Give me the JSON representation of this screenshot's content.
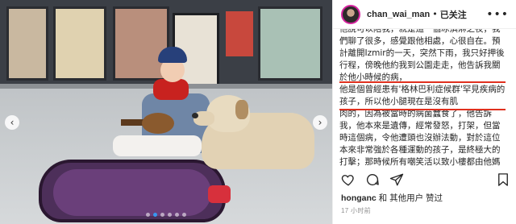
{
  "post": {
    "username": "chan_wai_man",
    "separator": "•",
    "follow_state": "已关注",
    "caption_top": "他說可以陪我，就是這一個冰淇淋之夜，我們聊了很多，感覺跟他相處，心很自在。預計離開Izmir的一天，突然下雨，我只好押後行程，傍晚他約我到公園走走，他告訴我關於他小時候的病，",
    "caption_highlight": "他是個曾經患有'格林巴利症候群'罕見疾病的孩子，所以他小腿現在是沒有肌",
    "caption_bottom": "肉的，因為被當時的病菌蠶食了，他告訴我，他本來是遺傳，經常發怒，打架，但當時這個病，令他遭頭也沒辦法動，對於這位本來非常強於各種運動的孩子，是終極大的打擊；那時候所有嘲笑活以致小樓都由他媽媽和兄弟協",
    "likes_user": "honganc",
    "likes_suffix": " 和 其他用户 赞过",
    "time": "17 小时前"
  },
  "photo": {
    "prev_icon": "‹",
    "next_icon": "›",
    "dots_count": 6,
    "active_dot": 1
  },
  "icons": {
    "more": "•••",
    "like": "heart-icon",
    "comment": "comment-icon",
    "share": "share-icon",
    "save": "bookmark-icon"
  },
  "colors": {
    "highlight_box": "#e0301e",
    "link_blue": "#3897f0",
    "text": "#262626",
    "muted": "#8e8e8e"
  }
}
